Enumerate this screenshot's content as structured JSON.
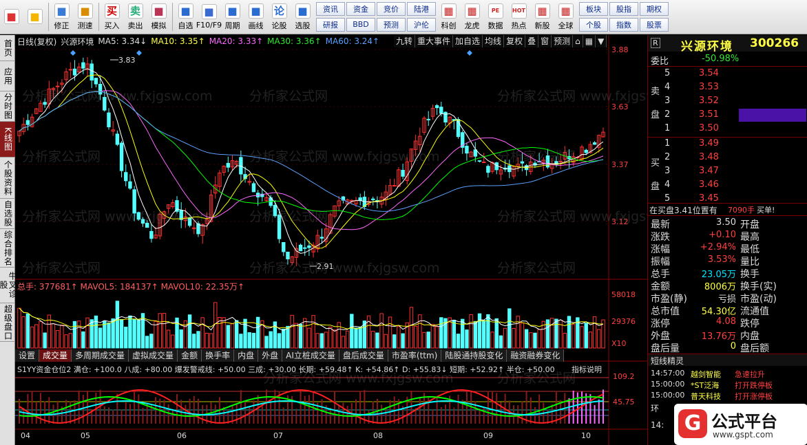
{
  "toolbar": {
    "buttons": [
      {
        "label": "",
        "icon": "app-logo-icon"
      },
      {
        "label": "",
        "icon": "back-arrow-icon"
      },
      {
        "label": "修正",
        "icon": "up-down-arrows-icon"
      },
      {
        "label": "测速",
        "icon": "clock-icon"
      },
      {
        "label": "买入",
        "icon": "buy-icon",
        "glyph": "买"
      },
      {
        "label": "卖出",
        "icon": "sell-icon",
        "glyph": "卖"
      },
      {
        "label": "模拟",
        "icon": "gavel-icon"
      },
      {
        "label": "自选",
        "icon": "star-icon"
      },
      {
        "label": "F10/F9",
        "icon": "f10-icon"
      },
      {
        "label": "周期",
        "icon": "cycle-icon"
      },
      {
        "label": "画线",
        "icon": "pencil-icon"
      },
      {
        "label": "论股",
        "icon": "forum-icon",
        "glyph": "论"
      },
      {
        "label": "选股",
        "icon": "select-icon"
      }
    ],
    "grid_buttons": [
      "资讯",
      "研报",
      "资金",
      "BBD",
      "竞价",
      "预测",
      "陆港",
      "沪伦"
    ],
    "buttons2": [
      {
        "label": "科创",
        "icon": "chart-icon"
      },
      {
        "label": "龙虎",
        "icon": "dragon-icon"
      },
      {
        "label": "数据",
        "icon": "pe-icon",
        "glyph": "PE"
      },
      {
        "label": "热点",
        "icon": "hot-icon",
        "glyph": "HOT"
      },
      {
        "label": "新股",
        "icon": "new-stock-icon"
      },
      {
        "label": "全球",
        "icon": "globe-icon"
      }
    ],
    "grid_buttons2": [
      "板块",
      "个股",
      "股指",
      "指数",
      "期权",
      "股票"
    ]
  },
  "left_tabs": [
    "首页",
    "应用",
    "分时图",
    "K线图",
    "个股资料",
    "自选股",
    "综合排名",
    "牛叉诊股",
    "超级盘口"
  ],
  "header": {
    "period": "日线(复权)",
    "name": "兴源环境",
    "ma5": "MA5: 3.34↓",
    "ma10": "MA10: 3.35↑",
    "ma20": "MA20: 3.33↑",
    "ma30": "MA30: 3.36↑",
    "ma60": "MA60: 3.24↑",
    "controls": [
      "九转",
      "重大事件",
      "加自选",
      "均线",
      "复权",
      "叠",
      "窗",
      "预测"
    ]
  },
  "price_axis": [
    "3.88",
    "3.63",
    "3.37",
    "3.12"
  ],
  "annotations": {
    "high": "3.83",
    "low": "2.91"
  },
  "volume": {
    "label": "总手: 377681↑ MAVOL5: 184137↑ MAVOL10: 22.35万↑",
    "axis": [
      "58018",
      "29376",
      "X10"
    ]
  },
  "indicator_tabs": [
    "设置",
    "成交量",
    "多周期成交量",
    "虚拟成交量",
    "金额",
    "换手率",
    "内盘",
    "外盘",
    "AI立桩成交量",
    "盘后成交量",
    "市盈率(ttm)",
    "陆股通持股变化",
    "融资融券变化"
  ],
  "indicator": {
    "label": "S1YY资金仓位2 满仓: +100.0 八成: +80.00 爆发警戒线: +50.00 三成: +30.00 长期: +59.48↑ K: +54.86↑ D: +55.83↓ 短期: +52.92↑ 半仓: +50.00",
    "help": "指标说明",
    "axis": [
      "109.2",
      "45.75"
    ]
  },
  "time_axis": [
    "04",
    "05",
    "06",
    "07",
    "08",
    "09",
    "10"
  ],
  "watermark": [
    "分析家公式网 www.fxjgsw.com",
    "分析家公式网"
  ],
  "right": {
    "title": "兴源环境",
    "code": "300266",
    "r_badge": "R",
    "ratio_label": "委比",
    "ratio": "-50.98%",
    "sell_label": "卖盘",
    "buy_label": "买盘",
    "asks": [
      [
        "5",
        "3.54"
      ],
      [
        "4",
        "3.53"
      ],
      [
        "3",
        "3.52"
      ],
      [
        "2",
        "3.51"
      ],
      [
        "1",
        "3.50"
      ]
    ],
    "bids": [
      [
        "1",
        "3.49"
      ],
      [
        "2",
        "3.48"
      ],
      [
        "3",
        "3.47"
      ],
      [
        "4",
        "3.46"
      ],
      [
        "5",
        "3.45"
      ]
    ],
    "notice": "在买盘3.41位置有",
    "notice_qty": "7090手",
    "notice_tag": "买单!",
    "stats_left": [
      [
        "最新",
        "3.50"
      ],
      [
        "涨跌",
        "+0.10"
      ],
      [
        "涨幅",
        "+2.94%"
      ],
      [
        "振幅",
        "3.53%"
      ],
      [
        "总手",
        "23.05万"
      ],
      [
        "金额",
        "8006万"
      ],
      [
        "市盈(静)",
        "亏损"
      ],
      [
        "总市值",
        "54.30亿"
      ],
      [
        "涨停",
        "4.08"
      ],
      [
        "外盘",
        "13.76万"
      ],
      [
        "盘后量",
        "0"
      ]
    ],
    "stats_right": [
      "开盘",
      "最高",
      "最低",
      "量比",
      "换手",
      "换手(实)",
      "市盈(动)",
      "流通值",
      "跌停",
      "内盘",
      "盘后额"
    ],
    "sprite_title": "短线精灵",
    "sprites": [
      [
        "14:57:00",
        "越剑智能",
        "急速拉升"
      ],
      [
        "15:00:00",
        "*ST泛海",
        "打开跌停板"
      ],
      [
        "15:00:00",
        "普天科技",
        "打开涨停板"
      ]
    ],
    "bottom": [
      "环",
      "14:"
    ],
    "logo": "公式平台",
    "logo_url": "www.gspt.com"
  },
  "colors": {
    "up": "#ff3030",
    "down": "#54ffff",
    "ma5": "#ffffff",
    "ma10": "#ffff00",
    "ma20": "#ff66ff",
    "ma30": "#00ff00",
    "ma60": "#5aa0ff"
  }
}
